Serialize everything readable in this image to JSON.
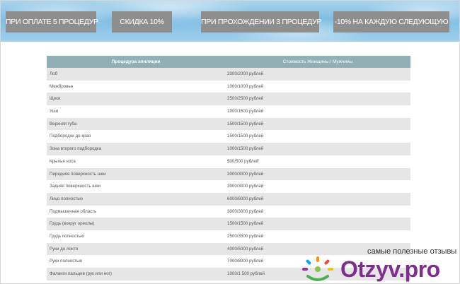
{
  "banner": {
    "buttons": [
      "ПРИ ОПЛАТЕ 5 ПРОЦЕДУР",
      "СКИДКА 10%",
      "ПРИ ПРОХОЖДЕНИИ 3 ПРОЦЕДУР",
      "-10% НА КАЖДУЮ СЛЕДУЮЩУЮ"
    ]
  },
  "table": {
    "headers": [
      "Процедура эпиляции",
      "Стоимость Женщины / Мужчины"
    ],
    "rows": [
      [
        "Лоб",
        "2000/2000 рублей"
      ],
      [
        "Межбровье",
        "1000/1000 рублей"
      ],
      [
        "Щеки",
        "2500/2500 рублей"
      ],
      [
        "Уши",
        "1000/1500 рублей"
      ],
      [
        "Верхняя губа",
        "1500/1500 рублей"
      ],
      [
        "Подбородок до края",
        "1500/1500 рублей"
      ],
      [
        "Зона второго подбородка",
        "1000/1500 рублей"
      ],
      [
        "Крылья носа",
        "500/500 рублей"
      ],
      [
        "Передняя поверхность шеи",
        "3000/3000 рублей"
      ],
      [
        "Задняя поверхность шеи",
        "3000/3000 рублей"
      ],
      [
        "Лицо полностью",
        "6000/6000 рублей"
      ],
      [
        "Подмышечная область",
        "3000/3000 рублей"
      ],
      [
        "Грудь (вокруг ореолы)",
        "1500/1500 рублей"
      ],
      [
        "Грудь полностью",
        "2500/3500 рублей"
      ],
      [
        "Руки до локтя",
        "4000/5000 рублей"
      ],
      [
        "Руки полностью",
        "7000/8000 рублей"
      ],
      [
        "Фаланги пальцев (рук или ног)",
        "1000/1 500 рублей"
      ]
    ]
  },
  "watermark": {
    "tagline": "самые полезные отзывы",
    "logo": "Otzyv.pro"
  }
}
